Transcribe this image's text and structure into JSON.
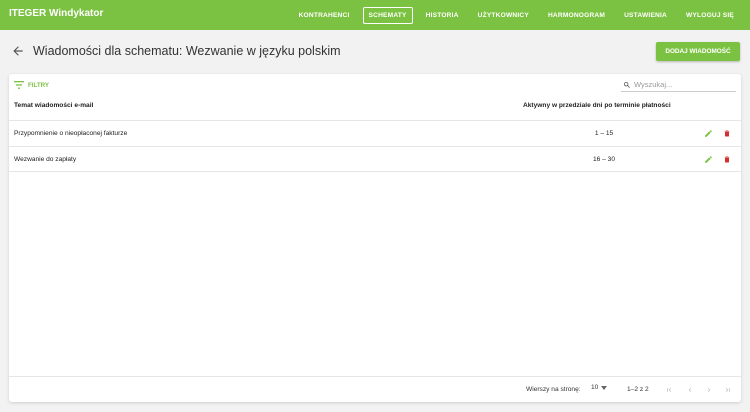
{
  "app": {
    "title": "ITEGER Windykator"
  },
  "nav": {
    "items": [
      {
        "label": "KONTRAHENCI",
        "active": false
      },
      {
        "label": "SCHEMATY",
        "active": true
      },
      {
        "label": "HISTORIA",
        "active": false
      },
      {
        "label": "UŻYTKOWNICY",
        "active": false
      },
      {
        "label": "HARMONOGRAM",
        "active": false
      },
      {
        "label": "USTAWIENIA",
        "active": false
      },
      {
        "label": "WYLOGUJ SIĘ",
        "active": false
      }
    ]
  },
  "header": {
    "title": "Wiadomości dla schematu: Wezwanie w języku polskim",
    "add_button": "DODAJ WIADOMOŚĆ"
  },
  "toolbar": {
    "filters_label": "FILTRY",
    "search_placeholder": "Wyszukaj..."
  },
  "table": {
    "columns": [
      "Temat wiadomości e-mail",
      "Aktywny w przedziale dni po terminie płatności"
    ],
    "rows": [
      {
        "subject": "Przypomnienie o nieopłaconej fakturze",
        "range": "1 – 15"
      },
      {
        "subject": "Wezwanie do zapłaty",
        "range": "16 – 30"
      }
    ]
  },
  "pagination": {
    "rows_per_page_label": "Wierszy na stronę:",
    "rows_per_page": "10",
    "range_label": "1–2 z 2"
  },
  "colors": {
    "brand": "#7cc242",
    "delete": "#d32f2f",
    "icon_muted": "#bdbdbd"
  }
}
